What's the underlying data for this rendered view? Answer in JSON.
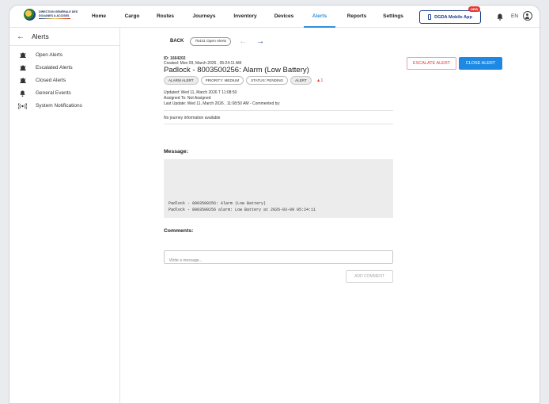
{
  "brand": {
    "logo_text": "DIRECTION GÉNÉRALE DES DOUANES & ACCISES"
  },
  "nav": {
    "items": [
      {
        "label": "Home"
      },
      {
        "label": "Cargo"
      },
      {
        "label": "Routes"
      },
      {
        "label": "Journeys"
      },
      {
        "label": "Inventory"
      },
      {
        "label": "Devices"
      },
      {
        "label": "Alerts",
        "active": true
      },
      {
        "label": "Reports"
      },
      {
        "label": "Settings"
      }
    ],
    "mobile_app_label": "DGDA Mobile App",
    "new_badge": "NEW",
    "language": "EN",
    "active_color": "#2f8fdf"
  },
  "sidebar": {
    "title": "Alerts",
    "items": [
      {
        "label": "Open Alerts",
        "icon": "alarm-icon"
      },
      {
        "label": "Escalated Alerts",
        "icon": "alarm-icon"
      },
      {
        "label": "Closed Alerts",
        "icon": "alarm-icon"
      },
      {
        "label": "General Events",
        "icon": "bell-icon"
      },
      {
        "label": "System Notifications",
        "icon": "broadcast-icon"
      }
    ]
  },
  "detail": {
    "back_label": "BACK",
    "open_alerts_count": "75431 Open Alerts",
    "id_line": "ID: 1664202",
    "created_line": "Created: Mon 09, March 2026 , 05:24:11 AM",
    "title": "Padlock - 8003500256: Alarm (Low Battery)",
    "chips": [
      "ALARM ALERT",
      "PRIORITY: MEDIUM",
      "STATUS: PENDING",
      "ALERT"
    ],
    "warning_count": "1",
    "updated_line": "Updated: Wed 11, March 2026 T 11:08:50",
    "assigned_line": "Assigned To: Not Assigned",
    "last_update_line": "Last Update: Wed 11, March 2026 , 11:08:50 AM - Commented by:",
    "journey_info": "No journey information available",
    "escalate_label": "ESCALATE ALERT",
    "close_label": "CLOSE ALERT",
    "message_heading": "Message:",
    "message_lines": [
      "Padlock - 8003500256: Alarm (Low Battery)",
      "Padlock - 8003500256 alarm: Low Battery at 2026-03-09 05:24:11"
    ],
    "comments_heading": "Comments:",
    "comment_placeholder": "Write a message...",
    "add_comment_label": "ADD COMMENT",
    "colors": {
      "primary": "#1e88e5",
      "danger": "#e53935"
    }
  }
}
